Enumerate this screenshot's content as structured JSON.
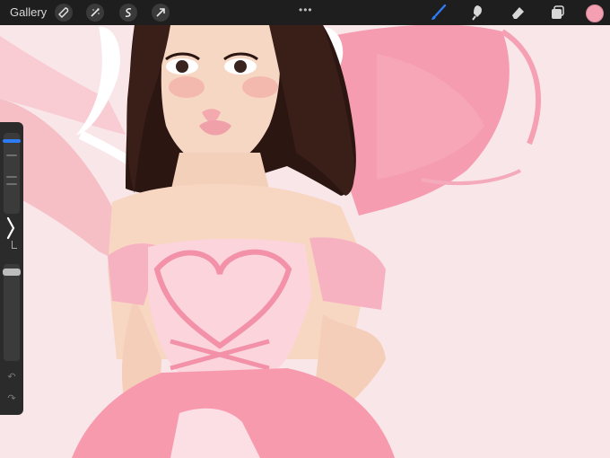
{
  "topbar": {
    "gallery_label": "Gallery",
    "more_label": "•••",
    "tools": [
      "wrench-icon",
      "adjustments-icon",
      "selection-icon",
      "transform-icon"
    ],
    "right_tools": [
      "brush-icon",
      "smudge-icon",
      "eraser-icon",
      "layers-icon"
    ],
    "active_color": "#f59fb2"
  },
  "sidebar": {
    "size_slider_value": 0.08,
    "opacity_slider_value": 0.05,
    "undo_label": "↶",
    "redo_label": "↷"
  },
  "colors": {
    "canvas_bg": "#f9e6e8",
    "accent": "#2e7bf6",
    "pink": "#f5a3b2"
  }
}
